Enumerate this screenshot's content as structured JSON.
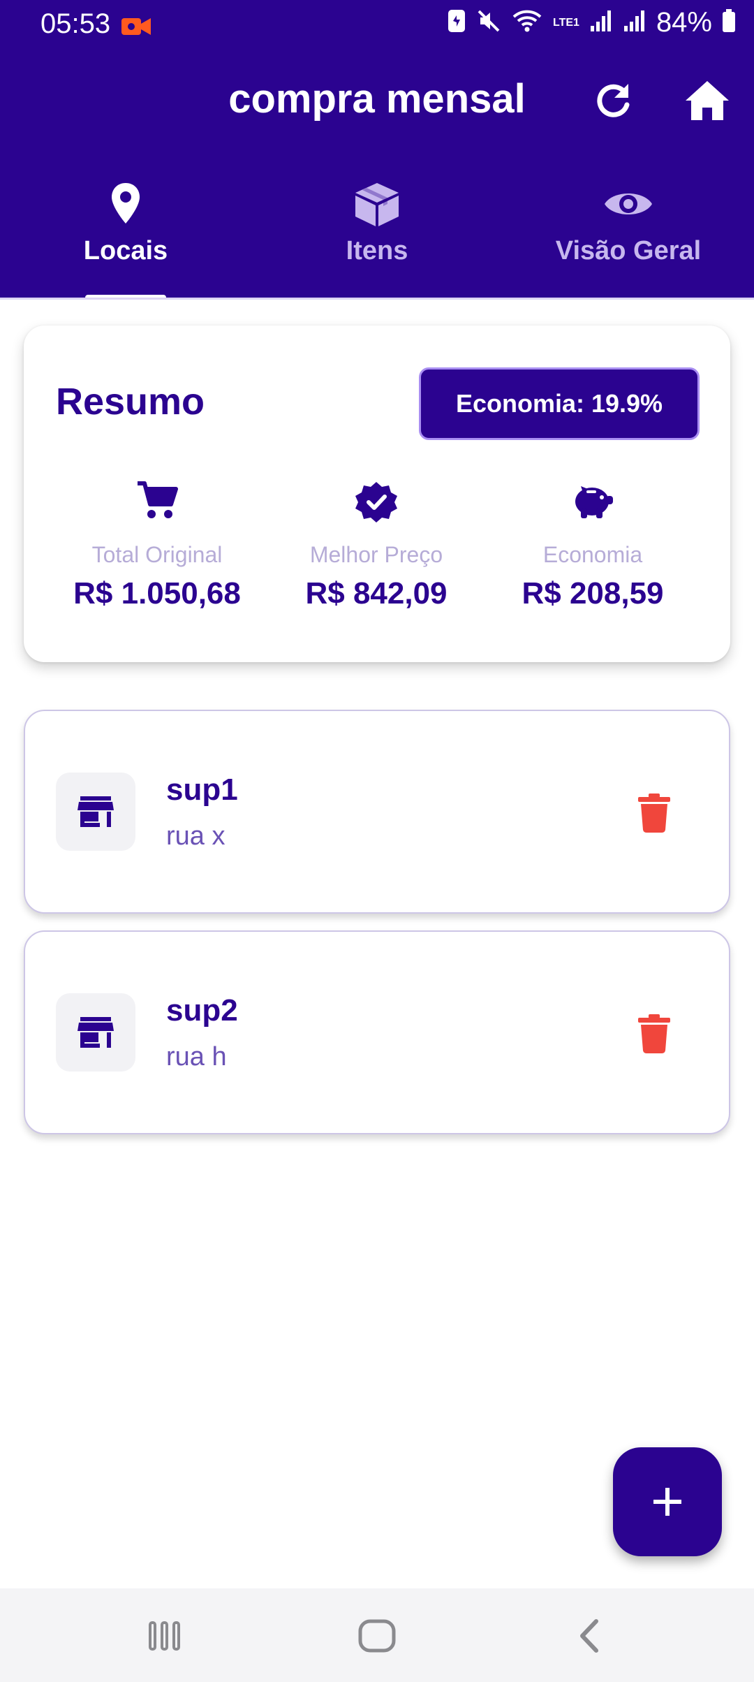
{
  "status_bar": {
    "time": "05:53",
    "battery_percent": "84%",
    "network_label": "LTE1"
  },
  "app_bar": {
    "title": "compra mensal",
    "refresh_icon": "refresh-icon",
    "home_icon": "home-icon"
  },
  "tabs": [
    {
      "label": "Locais",
      "icon": "location-pin-icon",
      "active": true
    },
    {
      "label": "Itens",
      "icon": "box-icon",
      "active": false
    },
    {
      "label": "Visão Geral",
      "icon": "eye-icon",
      "active": false
    }
  ],
  "summary": {
    "heading": "Resumo",
    "badge": "Economia: 19.9%",
    "metrics": [
      {
        "label": "Total Original",
        "value": "R$ 1.050,68",
        "icon": "cart-icon"
      },
      {
        "label": "Melhor Preço",
        "value": "R$ 842,09",
        "icon": "verified-badge-icon"
      },
      {
        "label": "Economia",
        "value": "R$ 208,59",
        "icon": "piggy-bank-icon"
      }
    ]
  },
  "locations": [
    {
      "name": "sup1",
      "address": "rua x",
      "icon": "store-icon",
      "action_icon": "trash-icon"
    },
    {
      "name": "sup2",
      "address": "rua h",
      "icon": "store-icon",
      "action_icon": "trash-icon"
    }
  ],
  "fab": {
    "icon": "plus-icon"
  },
  "colors": {
    "primary": "#2b0390",
    "delete": "#f0463c",
    "muted_label": "#b6acd7"
  }
}
